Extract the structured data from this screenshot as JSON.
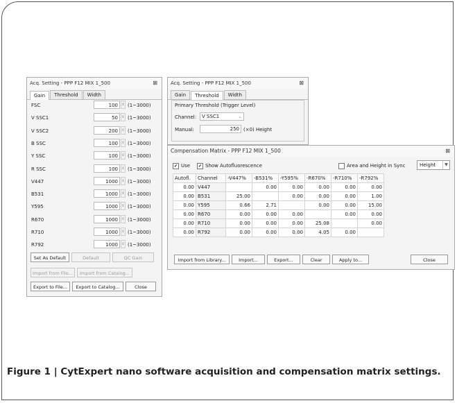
{
  "acq": {
    "title": "Acq. Setting - PPP F12 MIX 1_500",
    "close": "⊠",
    "tabs": [
      "Gain",
      "Threshold",
      "Width"
    ],
    "gains": [
      {
        "channel": "FSC",
        "value": "100",
        "range": "(1~3000)"
      },
      {
        "channel": "V SSC1",
        "value": "50",
        "range": "(1~3000)"
      },
      {
        "channel": "V SSC2",
        "value": "200",
        "range": "(1~3000)"
      },
      {
        "channel": "B SSC",
        "value": "100",
        "range": "(1~3000)"
      },
      {
        "channel": "Y SSC",
        "value": "100",
        "range": "(1~3000)"
      },
      {
        "channel": "R SSC",
        "value": "100",
        "range": "(1~3000)"
      },
      {
        "channel": "V447",
        "value": "1000",
        "range": "(1~3000)"
      },
      {
        "channel": "B531",
        "value": "1000",
        "range": "(1~3000)"
      },
      {
        "channel": "Y595",
        "value": "1000",
        "range": "(1~3000)"
      },
      {
        "channel": "R670",
        "value": "1000",
        "range": "(1~3000)"
      },
      {
        "channel": "R710",
        "value": "1000",
        "range": "(1~3000)"
      },
      {
        "channel": "R792",
        "value": "1000",
        "range": "(1~3000)"
      }
    ],
    "buttons": {
      "set_default": "Set As Default",
      "default": "Default",
      "qc_gain": "QC Gain",
      "import_file": "Import from File...",
      "import_catalog": "Import from Catalog...",
      "export_file": "Export to File...",
      "export_catalog": "Export to Catalog...",
      "close": "Close"
    }
  },
  "thr": {
    "title": "Acq. Setting - PPP F12 MIX 1_500",
    "close": "⊠",
    "tabs": [
      "Gain",
      "Threshold",
      "Width"
    ],
    "group_label": "Primary Threshold (Trigger Level)",
    "channel_label": "Channel:",
    "channel_value": "V SSC1",
    "manual_label": "Manual:",
    "manual_value": "250",
    "manual_suffix": "(×0)  Height"
  },
  "comp": {
    "title": "Compensation Matrix - PPP F12 MIX 1_500",
    "close": "⊠",
    "use_label": "Use",
    "show_af_label": "Show Autofluorescence",
    "area_height_label": "Area and Height in Sync",
    "height_select": "Height",
    "columns": [
      "Autofl.",
      "Channel",
      "-V447%",
      "-B531%",
      "-Y595%",
      "-R670%",
      "-R710%",
      "-R792%"
    ],
    "rows": [
      [
        "0.00",
        "V447",
        "",
        "0.00",
        "0.00",
        "0.00",
        "0.00",
        "0.00"
      ],
      [
        "0.00",
        "B531",
        "25.00",
        "",
        "0.00",
        "0.00",
        "0.00",
        "1.00"
      ],
      [
        "0.00",
        "Y595",
        "0.66",
        "2.71",
        "",
        "0.00",
        "0.00",
        "15.00"
      ],
      [
        "0.00",
        "R670",
        "0.00",
        "0.00",
        "0.00",
        "",
        "0.00",
        "0.00"
      ],
      [
        "0.00",
        "R710",
        "0.00",
        "0.00",
        "0.00",
        "25.08",
        "",
        "0.00"
      ],
      [
        "0.00",
        "R792",
        "0.00",
        "0.00",
        "0.00",
        "4.05",
        "0.00",
        ""
      ]
    ],
    "buttons": {
      "import_library": "Import from Library...",
      "import": "Import...",
      "export": "Export...",
      "clear": "Clear",
      "apply": "Apply to...",
      "close": "Close"
    }
  },
  "caption": "Figure 1 | CytExpert nano software acquisition and compensation matrix settings."
}
